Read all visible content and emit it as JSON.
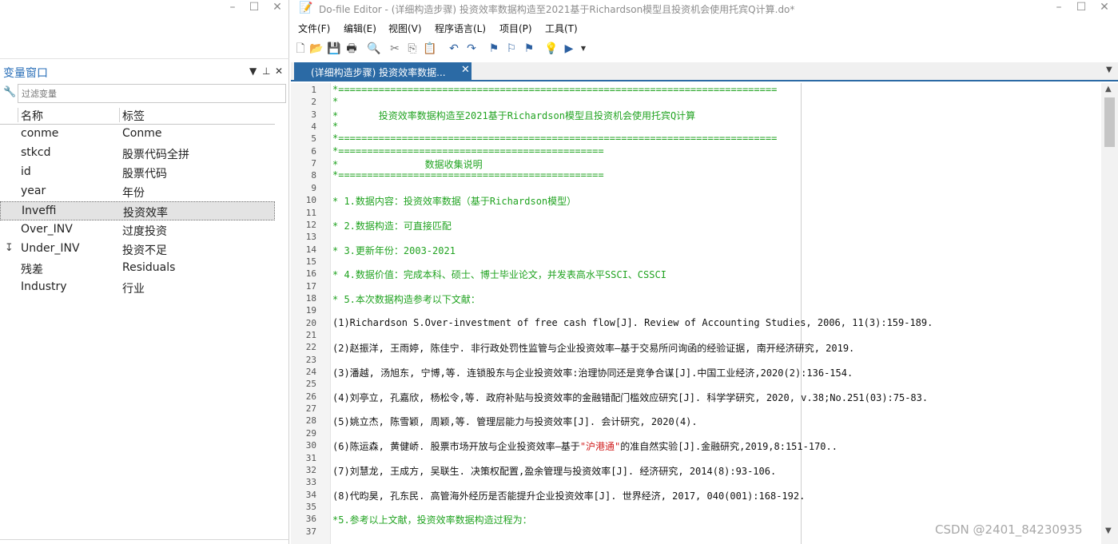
{
  "left_pane": {
    "window_controls": {
      "minimize": "–",
      "maximize": "☐",
      "close": "✕"
    },
    "title": "变量窗口",
    "pane_controls": {
      "filter": "▼",
      "pin": "⊥",
      "close": "✕"
    },
    "filter_placeholder": "过滤变量",
    "columns": {
      "name": "名称",
      "label": "标签"
    },
    "variables": [
      {
        "name": "conme",
        "label": "Conme",
        "marker": ""
      },
      {
        "name": "stkcd",
        "label": "股票代码全拼",
        "marker": ""
      },
      {
        "name": "id",
        "label": "股票代码",
        "marker": ""
      },
      {
        "name": "year",
        "label": "年份",
        "marker": ""
      },
      {
        "name": "Inveffi",
        "label": "投资效率",
        "marker": "",
        "selected": true
      },
      {
        "name": "Over_INV",
        "label": "过度投资",
        "marker": ""
      },
      {
        "name": "Under_INV",
        "label": "投资不足",
        "marker": "↧"
      },
      {
        "name": "残差",
        "label": "Residuals",
        "marker": ""
      },
      {
        "name": "Industry",
        "label": "行业",
        "marker": ""
      }
    ]
  },
  "editor": {
    "title": "Do-file Editor -  (详细构造步骤) 投资效率数据构造至2021基于Richardson模型且投资机会使用托宾Q计算.do*",
    "window_controls": {
      "minimize": "–",
      "maximize": "☐",
      "close": "✕"
    },
    "menu": [
      "文件(F)",
      "编辑(E)",
      "视图(V)",
      "程序语言(L)",
      "项目(P)",
      "工具(T)"
    ],
    "toolbar_icons": [
      "new-file-icon",
      "open-folder-icon",
      "save-icon",
      "print-icon",
      "find-icon",
      "cut-icon",
      "copy-icon",
      "paste-icon",
      "undo-icon",
      "redo-icon",
      "toggle-bookmark-icon",
      "previous-bookmark-icon",
      "next-bookmark-icon",
      "show-hints-icon",
      "run-icon",
      "dropdown-icon"
    ],
    "tab_label": "(详细构造步骤) 投资效率数据...",
    "tab_close": "✕",
    "tab_dropdown": "▼",
    "lines": [
      {
        "n": "1",
        "text": "*============================================================================",
        "color": "green"
      },
      {
        "n": "2",
        "text": "*",
        "color": "green"
      },
      {
        "n": "3",
        "text": "*       投资效率数据构造至2021基于Richardson模型且投资机会使用托宾Q计算",
        "color": "green"
      },
      {
        "n": "4",
        "text": "*",
        "color": "green"
      },
      {
        "n": "5",
        "text": "*============================================================================",
        "color": "green"
      },
      {
        "n": "6",
        "text": "*==============================================",
        "color": "green"
      },
      {
        "n": "7",
        "text": "*               数据收集说明",
        "color": "green"
      },
      {
        "n": "8",
        "text": "*==============================================",
        "color": "green"
      },
      {
        "n": "9",
        "text": "",
        "color": "green"
      },
      {
        "n": "10",
        "text": "* 1.数据内容：投资效率数据（基于Richardson模型）",
        "color": "green"
      },
      {
        "n": "11",
        "text": "",
        "color": "green"
      },
      {
        "n": "12",
        "text": "* 2.数据构造：可直接匹配",
        "color": "green"
      },
      {
        "n": "13",
        "text": "",
        "color": "green"
      },
      {
        "n": "14",
        "text": "* 3.更新年份：2003-2021",
        "color": "green"
      },
      {
        "n": "15",
        "text": "",
        "color": "green"
      },
      {
        "n": "16",
        "text": "* 4.数据价值：完成本科、硕士、博士毕业论文，并发表高水平SSCI、CSSCI",
        "color": "green"
      },
      {
        "n": "17",
        "text": "",
        "color": "green"
      },
      {
        "n": "18",
        "text": "* 5.本次数据构造参考以下文献：",
        "color": "green"
      },
      {
        "n": "19",
        "text": "",
        "color": "black"
      },
      {
        "n": "20",
        "text": "(1)Richardson S.Over-investment of free cash flow[J]. Review of Accounting Studies, 2006, 11(3):159-189.",
        "color": "black"
      },
      {
        "n": "21",
        "text": "",
        "color": "black"
      },
      {
        "n": "22",
        "text": "(2)赵振洋, 王雨婷, 陈佳宁. 非行政处罚性监管与企业投资效率—基于交易所问询函的经验证据, 南开经济研究, 2019.",
        "color": "black"
      },
      {
        "n": "23",
        "text": "",
        "color": "black"
      },
      {
        "n": "24",
        "text": "(3)潘越, 汤旭东, 宁博,等. 连锁股东与企业投资效率:治理协同还是竞争合谋[J].中国工业经济,2020(2):136-154.",
        "color": "black"
      },
      {
        "n": "25",
        "text": "",
        "color": "black"
      },
      {
        "n": "26",
        "text": "(4)刘亭立, 孔嘉欣, 杨松令,等. 政府补贴与投资效率的金融错配门槛效应研究[J]. 科学学研究, 2020, v.38;No.251(03):75-83.",
        "color": "black"
      },
      {
        "n": "27",
        "text": "",
        "color": "black"
      },
      {
        "n": "28",
        "text": "(5)姚立杰, 陈雪颖, 周颖,等. 管理层能力与投资效率[J]. 会计研究, 2020(4).",
        "color": "black"
      },
      {
        "n": "29",
        "text": "",
        "color": "black"
      },
      {
        "n": "30",
        "pre": "(6)陈运森, 黄健峤. 股票市场开放与企业投资效率—基于",
        "red": "\"沪港通\"",
        "post": "的准自然实验[J].金融研究,2019,8:151-170..",
        "color": "black"
      },
      {
        "n": "31",
        "text": "",
        "color": "black"
      },
      {
        "n": "32",
        "text": "(7)刘慧龙, 王成方, 吴联生. 决策权配置,盈余管理与投资效率[J]. 经济研究, 2014(8):93-106.",
        "color": "black"
      },
      {
        "n": "33",
        "text": "",
        "color": "black"
      },
      {
        "n": "34",
        "text": "(8)代昀昊, 孔东民. 高管海外经历是否能提升企业投资效率[J]. 世界经济, 2017, 040(001):168-192.",
        "color": "black"
      },
      {
        "n": "35",
        "text": "",
        "color": "black"
      },
      {
        "n": "36",
        "text": "*5.参考以上文献，投资效率数据构造过程为：",
        "color": "green"
      },
      {
        "n": "37",
        "text": "",
        "color": "black"
      }
    ],
    "watermark": "CSDN @2401_84230935",
    "scroll": {
      "up": "▲",
      "down": "▼"
    }
  },
  "colors": {
    "tab_active": "#2b6aa5",
    "comment_green": "#21a321",
    "string_red": "#d12222",
    "title_blue": "#2a6fb8"
  }
}
